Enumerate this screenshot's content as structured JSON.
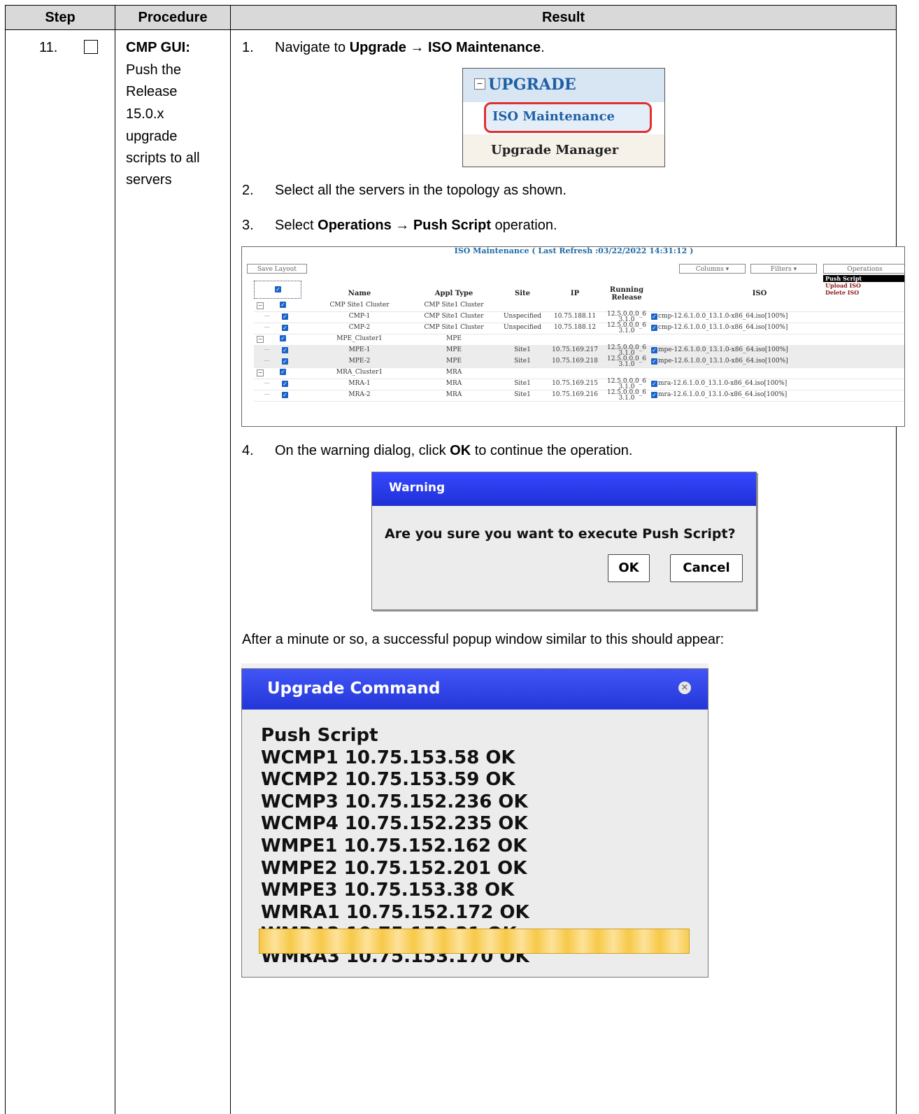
{
  "table": {
    "headers": {
      "step": "Step",
      "procedure": "Procedure",
      "result": "Result"
    },
    "step_number": "11.",
    "procedure_title": "CMP GUI:",
    "procedure_lines": [
      "Push the",
      "Release",
      "15.0.x",
      "upgrade",
      "scripts to all",
      "servers"
    ]
  },
  "instructions": {
    "s1_num": "1.",
    "s1_pre": "Navigate to ",
    "s1_bold": "Upgrade → ISO Maintenance",
    "s1_post": ".",
    "s2_num": "2.",
    "s2_text": "Select all the servers in the topology as shown.",
    "s3_num": "3.",
    "s3_pre": "Select ",
    "s3_bold": "Operations → Push Script",
    "s3_post": " operation.",
    "s4_num": "4.",
    "s4_pre": "On the warning dialog, click ",
    "s4_bold": "OK",
    "s4_post": " to continue the operation.",
    "after_text": "After a minute or so, a successful popup window similar to this should appear:"
  },
  "menu": {
    "minus": "−",
    "upgrade": "UPGRADE",
    "iso_maintenance": "ISO Maintenance",
    "upgrade_manager": "Upgrade Manager"
  },
  "iso_maintenance": {
    "title": "ISO Maintenance ( Last Refresh :03/22/2022 14:31:12 )",
    "save_layout": "Save Layout",
    "columns": "Columns",
    "filters": "Filters",
    "operations": "Operations",
    "operations_menu": [
      "Push Script",
      "Upload ISO",
      "Delete ISO"
    ],
    "headers": {
      "name": "Name",
      "appl_type": "Appl Type",
      "site": "Site",
      "ip": "IP",
      "running_release_1": "Running",
      "running_release_2": "Release",
      "iso": "ISO"
    },
    "rows": [
      {
        "name": "CMP Site1 Cluster",
        "appl": "CMP Site1 Cluster",
        "site": "",
        "ip": "",
        "rel1": "",
        "rel2": "",
        "iso": ""
      },
      {
        "name": "CMP-1",
        "appl": "CMP Site1 Cluster",
        "site": "Unspecified",
        "ip": "10.75.188.11",
        "rel1": "12.5.0.0.0_6",
        "rel2": "3.1.0",
        "iso": "cmp-12.6.1.0.0_13.1.0-x86_64.iso[100%]"
      },
      {
        "name": "CMP-2",
        "appl": "CMP Site1 Cluster",
        "site": "Unspecified",
        "ip": "10.75.188.12",
        "rel1": "12.5.0.0.0_6",
        "rel2": "3.1.0",
        "iso": "cmp-12.6.1.0.0_13.1.0-x86_64.iso[100%]"
      },
      {
        "name": "MPE_Cluster1",
        "appl": "MPE",
        "site": "",
        "ip": "",
        "rel1": "",
        "rel2": "",
        "iso": ""
      },
      {
        "name": "MPE-1",
        "appl": "MPE",
        "site": "Site1",
        "ip": "10.75.169.217",
        "rel1": "12.5.0.0.0_6",
        "rel2": "3.1.0",
        "iso": "mpe-12.6.1.0.0_13.1.0-x86_64.iso[100%]"
      },
      {
        "name": "MPE-2",
        "appl": "MPE",
        "site": "Site1",
        "ip": "10.75.169.218",
        "rel1": "12.5.0.0.0_6",
        "rel2": "3.1.0",
        "iso": "mpe-12.6.1.0.0_13.1.0-x86_64.iso[100%]"
      },
      {
        "name": "MRA_Cluster1",
        "appl": "MRA",
        "site": "",
        "ip": "",
        "rel1": "",
        "rel2": "",
        "iso": ""
      },
      {
        "name": "MRA-1",
        "appl": "MRA",
        "site": "Site1",
        "ip": "10.75.169.215",
        "rel1": "12.5.0.0.0_6",
        "rel2": "3.1.0",
        "iso": "mra-12.6.1.0.0_13.1.0-x86_64.iso[100%]"
      },
      {
        "name": "MRA-2",
        "appl": "MRA",
        "site": "Site1",
        "ip": "10.75.169.216",
        "rel1": "12.5.0.0.0_6",
        "rel2": "3.1.0",
        "iso": "mra-12.6.1.0.0_13.1.0-x86_64.iso[100%]"
      }
    ]
  },
  "warning_dialog": {
    "title": "Warning",
    "message": "Are you sure you want to execute Push Script?",
    "ok": "OK",
    "cancel": "Cancel"
  },
  "upgrade_dialog": {
    "title": "Upgrade Command",
    "close": "×",
    "lines": [
      "Push Script",
      "WCMP1 10.75.153.58  OK",
      "WCMP2 10.75.153.59  OK",
      "WCMP3 10.75.152.236  OK",
      "WCMP4 10.75.152.235  OK",
      "WMPE1 10.75.152.162  OK",
      "WMPE2 10.75.152.201  OK",
      "WMPE3 10.75.153.38  OK",
      "WMRA1 10.75.152.172  OK",
      "WMRA2 10.75.152.31  OK",
      "WMRA3 10.75.153.170  OK"
    ]
  },
  "colors": {
    "header_gray": "#d9d9d9",
    "dialog_blue": "#2436d8",
    "link_blue": "#1f5fa5",
    "highlight_red": "#e03030",
    "progress_yellow": "#f7c948"
  }
}
